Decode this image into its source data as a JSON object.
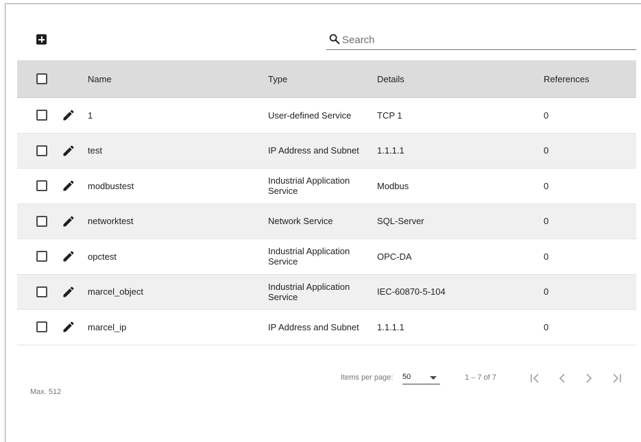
{
  "toolbar": {
    "add_icon": "plus-box-icon"
  },
  "search": {
    "placeholder": "Search",
    "value": "",
    "icon": "search-icon"
  },
  "table": {
    "columns": {
      "name": "Name",
      "type": "Type",
      "details": "Details",
      "references": "References"
    },
    "rows": [
      {
        "name": "1",
        "type": "User-defined Service",
        "details": "TCP 1",
        "references": "0"
      },
      {
        "name": "test",
        "type": "IP Address and Subnet",
        "details": "1.1.1.1",
        "references": "0"
      },
      {
        "name": "modbustest",
        "type": "Industrial Application Service",
        "details": "Modbus",
        "references": "0"
      },
      {
        "name": "networktest",
        "type": "Network Service",
        "details": "SQL-Server",
        "references": "0"
      },
      {
        "name": "opctest",
        "type": "Industrial Application Service",
        "details": "OPC-DA",
        "references": "0"
      },
      {
        "name": "marcel_object",
        "type": "Industrial Application Service",
        "details": "IEC-60870-5-104",
        "references": "0"
      },
      {
        "name": "marcel_ip",
        "type": "IP Address and Subnet",
        "details": "1.1.1.1",
        "references": "0"
      }
    ]
  },
  "footer": {
    "max": "Max. 512"
  },
  "paginator": {
    "items_per_page_label": "Items per page:",
    "items_per_page": "50",
    "range": "1 – 7 of 7",
    "icons": [
      "first-page-icon",
      "previous-page-icon",
      "next-page-icon",
      "last-page-icon"
    ]
  }
}
